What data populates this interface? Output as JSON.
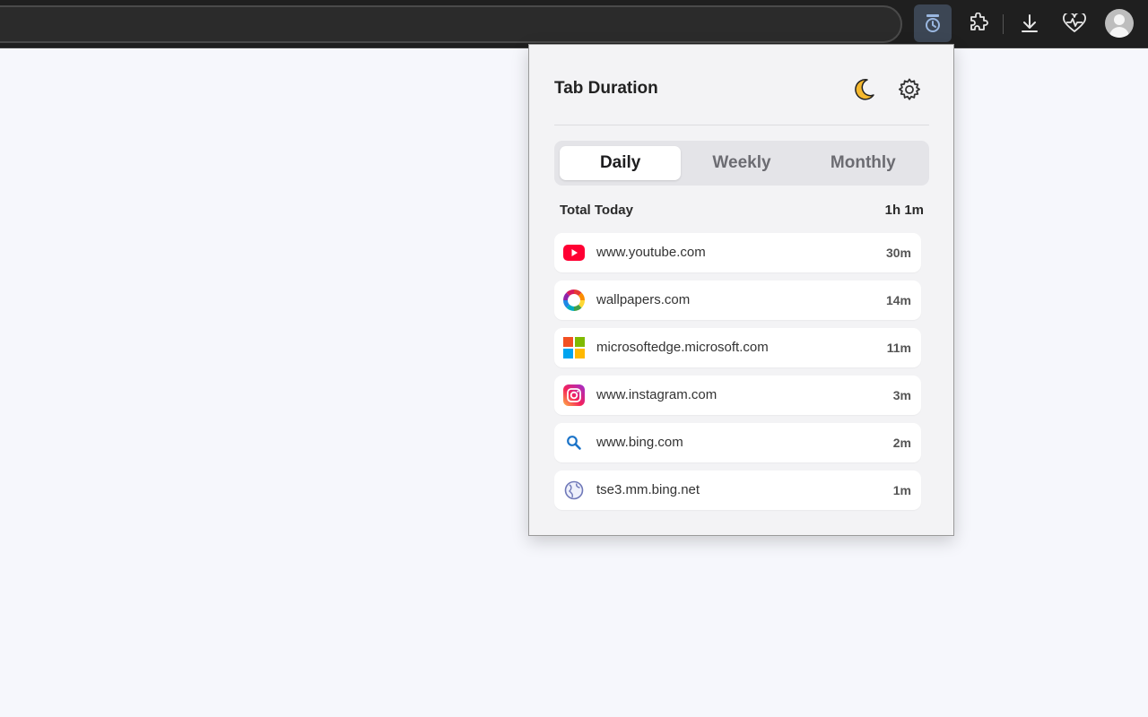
{
  "toolbar": {
    "buttons": [
      {
        "name": "tab-duration-extension-icon"
      },
      {
        "name": "extensions-puzzle-icon"
      },
      {
        "name": "download-icon"
      },
      {
        "name": "health-heart-icon"
      },
      {
        "name": "profile-avatar-icon"
      }
    ]
  },
  "popup": {
    "title": "Tab Duration",
    "icons": {
      "theme": "moon-icon",
      "settings": "gear-icon"
    },
    "tabs": [
      {
        "label": "Daily",
        "active": true
      },
      {
        "label": "Weekly",
        "active": false
      },
      {
        "label": "Monthly",
        "active": false
      }
    ],
    "total": {
      "label": "Total Today",
      "value": "1h 1m"
    },
    "sites": [
      {
        "name": "www.youtube.com",
        "time": "30m",
        "icon": "youtube-icon"
      },
      {
        "name": "wallpapers.com",
        "time": "14m",
        "icon": "wallpapers-icon"
      },
      {
        "name": "microsoftedge.microsoft.com",
        "time": "11m",
        "icon": "microsoft-icon"
      },
      {
        "name": "www.instagram.com",
        "time": "3m",
        "icon": "instagram-icon"
      },
      {
        "name": "www.bing.com",
        "time": "2m",
        "icon": "bing-search-icon"
      },
      {
        "name": "tse3.mm.bing.net",
        "time": "1m",
        "icon": "globe-icon"
      }
    ]
  },
  "colors": {
    "toolbar_bg": "#1f1f1f",
    "page_bg": "#f6f7fc",
    "popup_bg": "#f3f3f5",
    "youtube_red": "#ff0033",
    "moon_yellow": "#f5b82e"
  }
}
